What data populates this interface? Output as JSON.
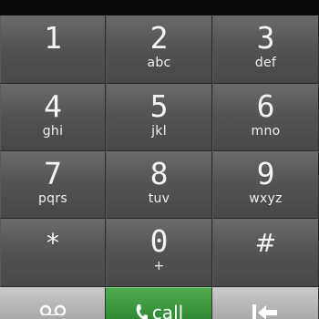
{
  "dialpad": {
    "keys": [
      {
        "num": "1",
        "letters": ""
      },
      {
        "num": "2",
        "letters": "abc"
      },
      {
        "num": "3",
        "letters": "def"
      },
      {
        "num": "4",
        "letters": "ghi"
      },
      {
        "num": "5",
        "letters": "jkl"
      },
      {
        "num": "6",
        "letters": "mno"
      },
      {
        "num": "7",
        "letters": "pqrs"
      },
      {
        "num": "8",
        "letters": "tuv"
      },
      {
        "num": "9",
        "letters": "wxyz"
      },
      {
        "num": "*",
        "letters": ""
      },
      {
        "num": "0",
        "letters": "+"
      },
      {
        "num": "#",
        "letters": ""
      }
    ]
  },
  "bottom_bar": {
    "voicemail_icon": "voicemail-icon",
    "call_label": "call",
    "call_icon": "phone-icon",
    "backspace_icon": "backspace-icon",
    "call_color": "#2f8a33"
  }
}
